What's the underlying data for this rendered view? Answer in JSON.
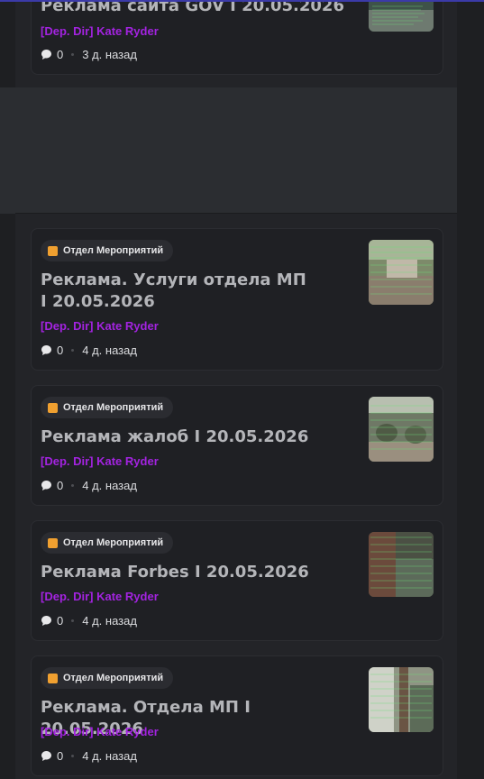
{
  "posts": [
    {
      "title": "Реклама сайта GOV I 20.05.2026",
      "author": "[Dep. Dir] Kate Ryder",
      "comments": "0",
      "time": "3 д. назад"
    },
    {
      "tag": "Отдел Мероприятий",
      "title": "Реклама. Услуги отдела МП I 20.05.2026",
      "author": "[Dep. Dir] Kate Ryder",
      "comments": "0",
      "time": "4 д. назад"
    },
    {
      "tag": "Отдел Мероприятий",
      "title": "Реклама жалоб I 20.05.2026",
      "author": "[Dep. Dir] Kate Ryder",
      "comments": "0",
      "time": "4 д. назад"
    },
    {
      "tag": "Отдел Мероприятий",
      "title": "Реклама Forbes I 20.05.2026",
      "author": "[Dep. Dir] Kate Ryder",
      "comments": "0",
      "time": "4 д. назад"
    },
    {
      "tag": "Отдел Мероприятий",
      "title": "Реклама. Отдела МП I 20.05.2026",
      "author": "[Dep. Dir] Kate Ryder",
      "comments": "0",
      "time": "4 д. назад"
    }
  ],
  "colors": {
    "background": "#1e1f22",
    "card": "#1f2024",
    "author": "#a323e0",
    "tag_icon": "#f0a030",
    "title": "#b4b5b9"
  },
  "icons": {
    "comment": "speech-bubble-icon",
    "tag": "square-tag-icon"
  }
}
